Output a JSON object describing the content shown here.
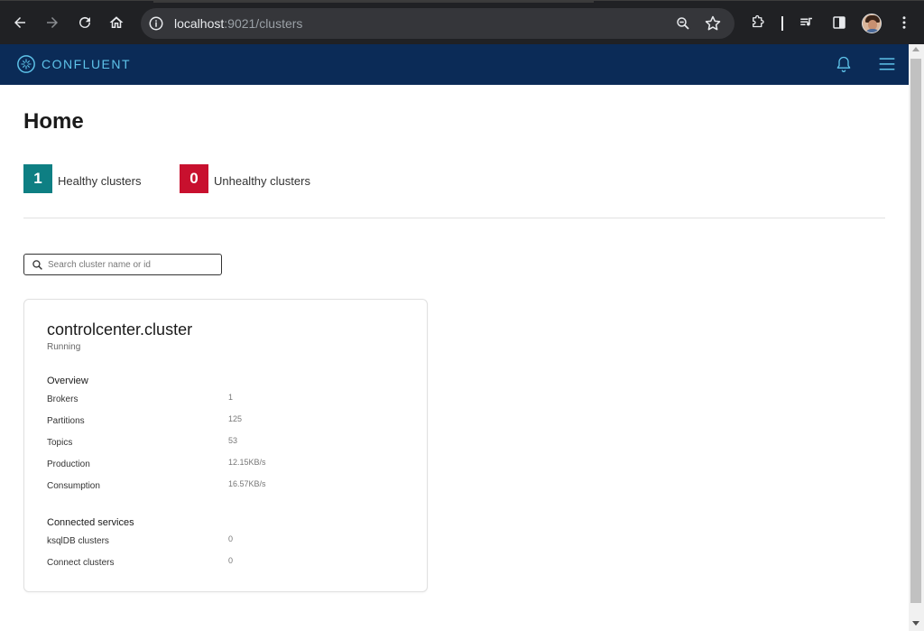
{
  "browser": {
    "url_host": "localhost",
    "url_rest": ":9021/clusters"
  },
  "header": {
    "logo_text": "CONFLUENT",
    "colors": {
      "background": "#0b2b57",
      "accent": "#5ec3ea"
    }
  },
  "page": {
    "title": "Home",
    "stats": {
      "healthy_count": "1",
      "healthy_label": "Healthy clusters",
      "unhealthy_count": "0",
      "unhealthy_label": "Unhealthy clusters",
      "healthy_color": "#0e7f83",
      "unhealthy_color": "#c8102e"
    },
    "search": {
      "placeholder": "Search cluster name or id",
      "value": ""
    },
    "cluster_card": {
      "name": "controlcenter.cluster",
      "status": "Running",
      "overview_title": "Overview",
      "overview": [
        {
          "label": "Brokers",
          "value": "1"
        },
        {
          "label": "Partitions",
          "value": "125"
        },
        {
          "label": "Topics",
          "value": "53"
        },
        {
          "label": "Production",
          "value": "12.15KB/s"
        },
        {
          "label": "Consumption",
          "value": "16.57KB/s"
        }
      ],
      "services_title": "Connected services",
      "services": [
        {
          "label": "ksqlDB clusters",
          "value": "0"
        },
        {
          "label": "Connect clusters",
          "value": "0"
        }
      ]
    }
  }
}
